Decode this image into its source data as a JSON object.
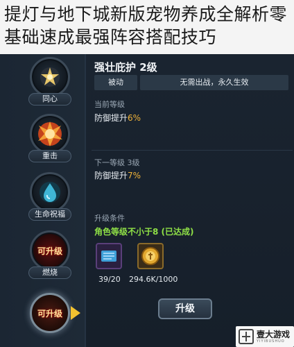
{
  "article": {
    "title": "提灯与地下城新版宠物养成全解析零基础速成最强阵容搭配技巧"
  },
  "sidebar": {
    "skills": [
      {
        "name": "同心",
        "icon": "star-sun-icon"
      },
      {
        "name": "重击",
        "icon": "burst-icon"
      },
      {
        "name": "生命祝福",
        "icon": "water-drop-icon"
      },
      {
        "name": "燃烧",
        "icon": "fire-icon",
        "badge": "可升级"
      },
      {
        "badge": "可升级",
        "icon": "chest-icon"
      }
    ]
  },
  "detail": {
    "title": "强壮庇护 2级",
    "type_tag": "被动",
    "duration_tag": "无需出战，永久生效",
    "current_label": "当前等级",
    "current_effect_prefix": "防御提升",
    "current_effect_value": "6%",
    "next_label": "下一等级 3级",
    "next_effect_prefix": "防御提升",
    "next_effect_value": "7%",
    "condition_label": "升级条件",
    "condition_text": "角色等级不小于8 (已达成)",
    "costs": [
      {
        "icon": "scroll-book-icon",
        "amount": "39/20"
      },
      {
        "icon": "gold-coin-icon",
        "amount": "294.6K/1000"
      }
    ],
    "upgrade_label": "升级"
  },
  "watermark": {
    "text": "壹大游戏",
    "sub": "YIYIBUSHUO"
  },
  "colors": {
    "accent_orange": "#f0b33a",
    "accent_green": "#8fe046",
    "arrow_gold": "#f2c230"
  }
}
